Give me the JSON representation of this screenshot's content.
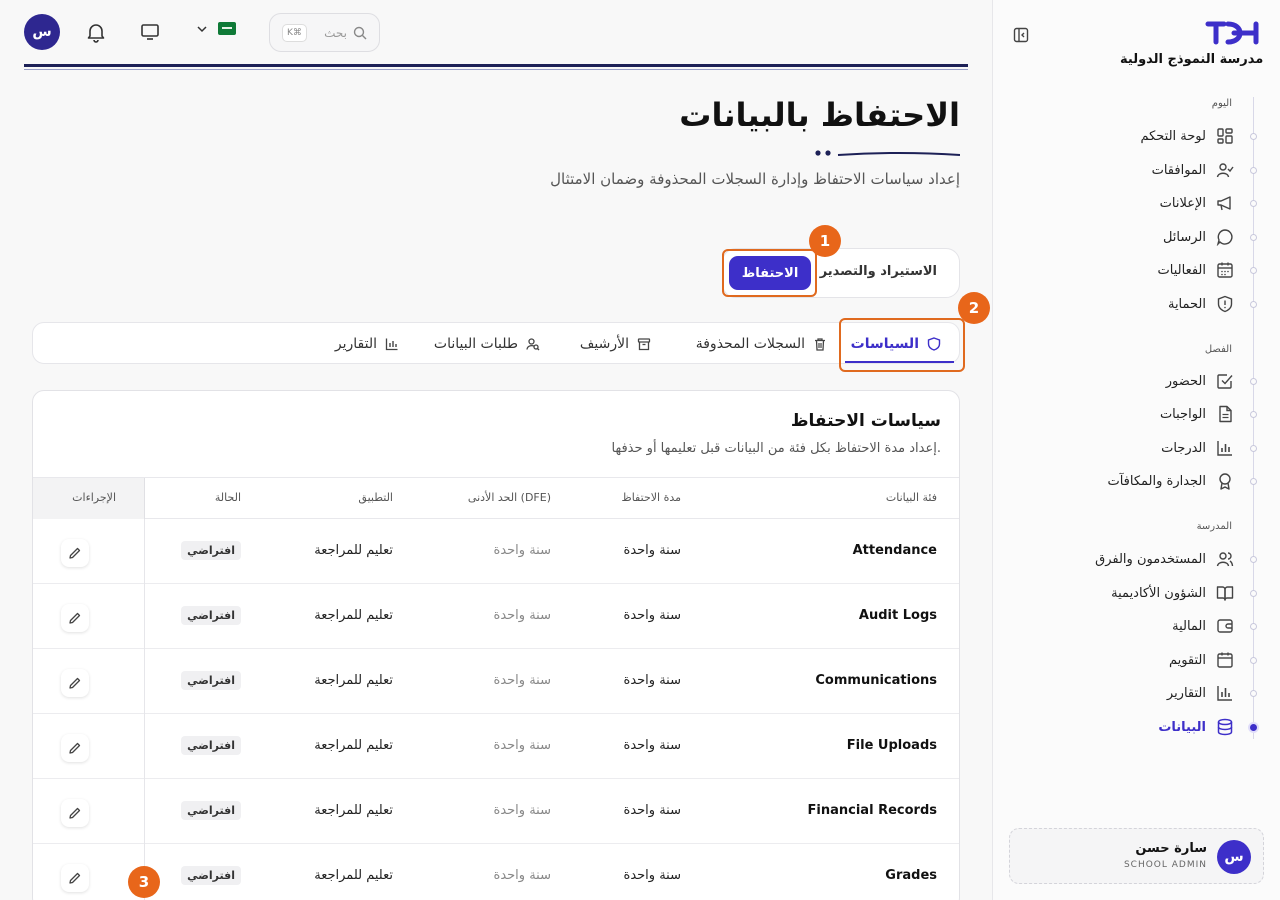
{
  "sidebar": {
    "school_name": "مدرسة النموذج الدولية",
    "sections": [
      {
        "label": "اليوم",
        "items": [
          {
            "label": "لوحة التحكم",
            "icon": "dashboard-icon"
          },
          {
            "label": "الموافقات",
            "icon": "user-check-icon"
          },
          {
            "label": "الإعلانات",
            "icon": "megaphone-icon"
          },
          {
            "label": "الرسائل",
            "icon": "message-icon"
          },
          {
            "label": "الفعاليات",
            "icon": "calendar-grid-icon"
          },
          {
            "label": "الحماية",
            "icon": "shield-alert-icon"
          }
        ]
      },
      {
        "label": "الفصل",
        "items": [
          {
            "label": "الحضور",
            "icon": "checkbox-icon"
          },
          {
            "label": "الواجبات",
            "icon": "document-icon"
          },
          {
            "label": "الدرجات",
            "icon": "bar-chart-icon"
          },
          {
            "label": "الجدارة والمكافآت",
            "icon": "award-icon"
          }
        ]
      },
      {
        "label": "المدرسة",
        "items": [
          {
            "label": "المستخدمون والفرق",
            "icon": "users-icon"
          },
          {
            "label": "الشؤون الأكاديمية",
            "icon": "book-icon"
          },
          {
            "label": "المالية",
            "icon": "wallet-icon"
          },
          {
            "label": "التقويم",
            "icon": "calendar-icon"
          },
          {
            "label": "التقارير",
            "icon": "report-icon"
          },
          {
            "label": "البيانات",
            "icon": "database-icon",
            "active": true
          }
        ]
      }
    ],
    "user": {
      "initial": "س",
      "name": "سارة حسن",
      "role": "SCHOOL ADMIN"
    }
  },
  "topbar": {
    "avatar_initial": "س",
    "search_placeholder": "بحث",
    "search_shortcut": "K⌘",
    "flag": "saudi-flag"
  },
  "page": {
    "title": "الاحتفاظ بالبيانات",
    "subtitle": "إعداد سياسات الاحتفاظ وإدارة السجلات المحذوفة وضمان الامتثال"
  },
  "main_tabs": {
    "import_export": "الاستيراد والتصدير",
    "retention": "الاحتفاظ"
  },
  "sub_tabs": [
    {
      "label": "السياسات",
      "icon": "shield-icon",
      "active": true
    },
    {
      "label": "السجلات المحذوفة",
      "icon": "trash-icon"
    },
    {
      "label": "الأرشيف",
      "icon": "archive-icon"
    },
    {
      "label": "طلبات البيانات",
      "icon": "user-search-icon"
    },
    {
      "label": "التقارير",
      "icon": "bar-chart-icon"
    }
  ],
  "card": {
    "title": "سياسات الاحتفاظ",
    "subtitle": "إعداد مدة الاحتفاظ بكل فئة من البيانات قبل تعليمها أو حذفها.",
    "columns": {
      "category": "فئة البيانات",
      "period": "مدة الاحتفاظ",
      "minimum": "الحد الأدنى (DFE)",
      "application": "التطبيق",
      "status": "الحالة",
      "actions": "الإجراءات"
    },
    "rows": [
      {
        "category": "Attendance",
        "period": "سنة واحدة",
        "minimum": "سنة واحدة",
        "application": "تعليم للمراجعة",
        "status": "افتراضي"
      },
      {
        "category": "Audit Logs",
        "period": "سنة واحدة",
        "minimum": "سنة واحدة",
        "application": "تعليم للمراجعة",
        "status": "افتراضي"
      },
      {
        "category": "Communications",
        "period": "سنة واحدة",
        "minimum": "سنة واحدة",
        "application": "تعليم للمراجعة",
        "status": "افتراضي"
      },
      {
        "category": "File Uploads",
        "period": "سنة واحدة",
        "minimum": "سنة واحدة",
        "application": "تعليم للمراجعة",
        "status": "افتراضي"
      },
      {
        "category": "Financial Records",
        "period": "سنة واحدة",
        "minimum": "سنة واحدة",
        "application": "تعليم للمراجعة",
        "status": "افتراضي"
      },
      {
        "category": "Grades",
        "period": "سنة واحدة",
        "minimum": "سنة واحدة",
        "application": "تعليم للمراجعة",
        "status": "افتراضي"
      }
    ]
  },
  "annotations": [
    "1",
    "2",
    "3"
  ],
  "colors": {
    "accent": "#3d2fc9",
    "highlight": "#e06a1f",
    "navy": "#1d2157"
  }
}
